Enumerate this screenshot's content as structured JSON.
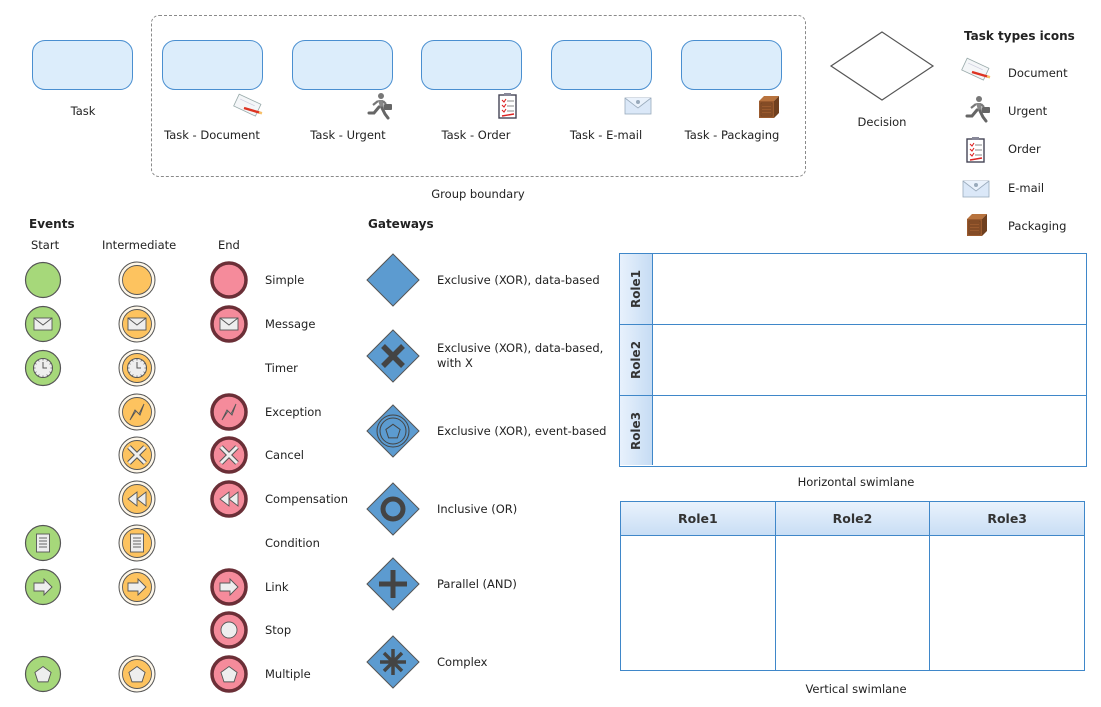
{
  "tasks": {
    "task": {
      "label": "Task"
    },
    "group_items": [
      {
        "label": "Task - Document",
        "icon": "document-icon"
      },
      {
        "label": "Task - Urgent",
        "icon": "urgent-runner-icon"
      },
      {
        "label": "Task - Order",
        "icon": "order-clipboard-icon"
      },
      {
        "label": "Task - E-mail",
        "icon": "email-envelope-icon"
      },
      {
        "label": "Task - Packaging",
        "icon": "packaging-box-icon"
      }
    ],
    "group_label": "Group boundary"
  },
  "decision": {
    "label": "Decision"
  },
  "task_types": {
    "title": "Task types icons",
    "items": [
      {
        "label": "Document",
        "icon": "document-icon"
      },
      {
        "label": "Urgent",
        "icon": "urgent-runner-icon"
      },
      {
        "label": "Order",
        "icon": "order-clipboard-icon"
      },
      {
        "label": "E-mail",
        "icon": "email-envelope-icon"
      },
      {
        "label": "Packaging",
        "icon": "packaging-box-icon"
      }
    ]
  },
  "events": {
    "title": "Events",
    "columns": {
      "start": "Start",
      "intermediate": "Intermediate",
      "end": "End"
    },
    "rows": [
      {
        "label": "Simple",
        "symbol": "none",
        "start": true,
        "intermediate": true,
        "end": true
      },
      {
        "label": "Message",
        "symbol": "envelope",
        "start": true,
        "intermediate": true,
        "end": true
      },
      {
        "label": "Timer",
        "symbol": "clock",
        "start": true,
        "intermediate": true,
        "end": false
      },
      {
        "label": "Exception",
        "symbol": "lightning",
        "start": false,
        "intermediate": true,
        "end": true
      },
      {
        "label": "Cancel",
        "symbol": "x",
        "start": false,
        "intermediate": true,
        "end": true
      },
      {
        "label": "Compensation",
        "symbol": "rewind",
        "start": false,
        "intermediate": true,
        "end": true
      },
      {
        "label": "Condition",
        "symbol": "document",
        "start": true,
        "intermediate": true,
        "end": false
      },
      {
        "label": "Link",
        "symbol": "arrow",
        "start": true,
        "intermediate": true,
        "end": true
      },
      {
        "label": "Stop",
        "symbol": "circle",
        "start": false,
        "intermediate": false,
        "end": true
      },
      {
        "label": "Multiple",
        "symbol": "pentagon",
        "start": true,
        "intermediate": true,
        "end": true
      }
    ],
    "colors": {
      "start": "#a6d87a",
      "intermediate": "#fdc35f",
      "end": "#f58b9b",
      "end_border": "#6b2f37"
    }
  },
  "gateways": {
    "title": "Gateways",
    "items": [
      {
        "label": "Exclusive (XOR), data-based",
        "label2": "",
        "symbol": "none"
      },
      {
        "label": "Exclusive (XOR), data-based,",
        "label2": "with X",
        "symbol": "x"
      },
      {
        "label": "Exclusive (XOR), event-based",
        "label2": "",
        "symbol": "event"
      },
      {
        "label": "Inclusive (OR)",
        "label2": "",
        "symbol": "circle"
      },
      {
        "label": "Parallel (AND)",
        "label2": "",
        "symbol": "plus"
      },
      {
        "label": "Complex",
        "label2": "",
        "symbol": "asterisk"
      }
    ],
    "color": "#5c9bd0"
  },
  "horizontal_swimlane": {
    "roles": [
      "Role1",
      "Role2",
      "Role3"
    ],
    "caption": "Horizontal swimlane"
  },
  "vertical_swimlane": {
    "roles": [
      "Role1",
      "Role2",
      "Role3"
    ],
    "caption": "Vertical swimlane"
  }
}
